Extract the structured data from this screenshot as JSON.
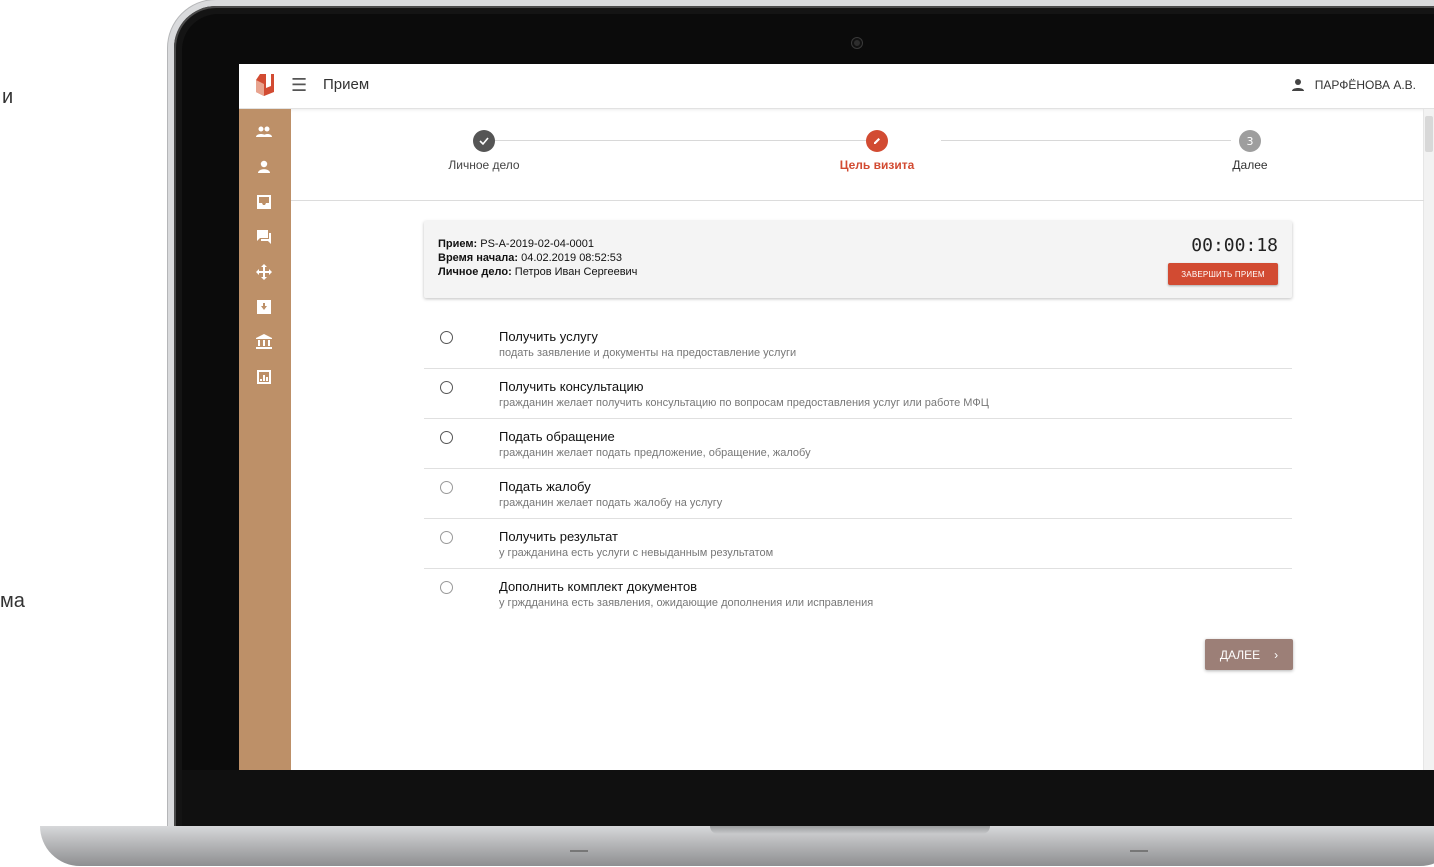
{
  "edge_text": {
    "line1": "и",
    "line2": "ма"
  },
  "header": {
    "app_title": "Прием",
    "user_name": "ПАРФЁНОВА А.В."
  },
  "icons": {
    "logo": "mfc-logo-icon",
    "menu": "hamburger-menu-icon",
    "user": "user-icon",
    "sidebar": [
      "people-icon",
      "person-icon",
      "inbox-icon",
      "chat-icon",
      "move-icon",
      "archive-icon",
      "bank-icon",
      "chart-icon"
    ]
  },
  "stepper": {
    "steps": [
      {
        "label": "Личное дело",
        "state": "done"
      },
      {
        "label": "Цель визита",
        "state": "active"
      },
      {
        "label": "Далее",
        "state": "pending",
        "number": "3"
      }
    ]
  },
  "card": {
    "reception_label": "Прием:",
    "reception_value": "PS-A-2019-02-04-0001",
    "start_label": "Время начала:",
    "start_value": "04.02.2019 08:52:53",
    "case_label": "Личное дело:",
    "case_value": "Петров Иван Сергеевич",
    "timer": "00:00:18",
    "finish_label": "ЗАВЕРШИТЬ ПРИЕМ"
  },
  "options": [
    {
      "title": "Получить услугу",
      "desc": "подать заявление и документы на предоставление услуги"
    },
    {
      "title": "Получить консультацию",
      "desc": "гражданин желает получить консультацию по вопросам предоставления услуг или работе МФЦ"
    },
    {
      "title": "Подать обращение",
      "desc": "гражданин желает подать предложение, обращение, жалобу"
    },
    {
      "title": "Подать жалобу",
      "desc": "гражданин желает подать жалобу на услугу"
    },
    {
      "title": "Получить результат",
      "desc": "у гражданина есть услуги с невыданным результатом"
    },
    {
      "title": "Дополнить комплект документов",
      "desc": "у грждданина есть заявления, ожидающие дополнения или исправления"
    }
  ],
  "next_button": {
    "label": "ДАЛЕЕ",
    "chevron": "›"
  },
  "colors": {
    "accent": "#d24b32",
    "sidebar": "#bd9068",
    "next_button": "#9c7f77",
    "done_step": "#555555"
  }
}
